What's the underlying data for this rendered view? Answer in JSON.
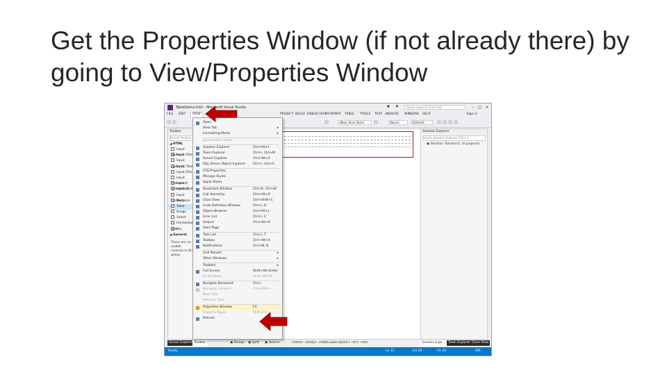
{
  "slide": {
    "title": "Get the Properties Window (if not already there) by going to View/Properties Window"
  },
  "window": {
    "title": "TableDemo.htm - Microsoft Visual Studio",
    "quick_launch": "Quick Launch (Ctrl+Q)",
    "sign_in": "Sign in"
  },
  "menu": {
    "items": [
      "FILE",
      "EDIT",
      "VIEW",
      "PROJECT",
      "BUILD",
      "DEBUG",
      "TEAM",
      "FORMAT",
      "TABLE",
      "TOOLS",
      "TEST",
      "ANALYZE",
      "WINDOW",
      "HELP"
    ]
  },
  "toolbar": {
    "style_select": "(New Inline Style)",
    "target_select": "(None)",
    "rule_select": "(Default)"
  },
  "toolbox": {
    "title": "Toolbox",
    "search": "Search Toolbox",
    "section": "HTML",
    "items": [
      "Input (Button)",
      "Input (Reset)",
      "Input (Submit)",
      "Input (Text)",
      "Input (File)",
      "Input (Password)",
      "Input (Checkbox)",
      "Input (Radio)",
      "Input (Hidden)",
      "Textarea",
      "Table",
      "Image",
      "Select",
      "Horizontal Rule",
      "Div"
    ],
    "general": "General",
    "general_text": "There are no usable controls in this group."
  },
  "view_menu": {
    "items": [
      {
        "label": "Open",
        "shortcut": "",
        "arrow": false,
        "disabled": false,
        "icon": "folder-icon"
      },
      {
        "label": "View Tab",
        "shortcut": "",
        "arrow": true,
        "disabled": false,
        "icon": ""
      },
      {
        "label": "Formatting Marks",
        "shortcut": "",
        "arrow": true,
        "disabled": false,
        "icon": ""
      },
      {
        "label": "Synchronize Views",
        "shortcut": "",
        "arrow": false,
        "disabled": true,
        "icon": ""
      },
      {
        "label": "Solution Explorer",
        "shortcut": "Ctrl+Alt+L",
        "arrow": false,
        "disabled": false,
        "icon": "solution-explorer-icon"
      },
      {
        "label": "Team Explorer",
        "shortcut": "Ctrl+\\, Ctrl+M",
        "arrow": false,
        "disabled": false,
        "icon": "team-explorer-icon"
      },
      {
        "label": "Server Explorer",
        "shortcut": "Ctrl+Alt+S",
        "arrow": false,
        "disabled": false,
        "icon": "server-explorer-icon"
      },
      {
        "label": "SQL Server Object Explorer",
        "shortcut": "Ctrl+\\, Ctrl+S",
        "arrow": false,
        "disabled": false,
        "icon": "sql-server-icon"
      },
      {
        "label": "CSS Properties",
        "shortcut": "",
        "arrow": false,
        "disabled": false,
        "icon": "css-properties-icon"
      },
      {
        "label": "Manage Styles",
        "shortcut": "",
        "arrow": false,
        "disabled": false,
        "icon": "manage-styles-icon"
      },
      {
        "label": "Apply Styles",
        "shortcut": "",
        "arrow": false,
        "disabled": false,
        "icon": "apply-styles-icon"
      },
      {
        "label": "Bookmark Window",
        "shortcut": "Ctrl+K, Ctrl+W",
        "arrow": false,
        "disabled": false,
        "icon": "bookmark-icon"
      },
      {
        "label": "Call Hierarchy",
        "shortcut": "Ctrl+Alt+K",
        "arrow": false,
        "disabled": false,
        "icon": "call-hierarchy-icon"
      },
      {
        "label": "Class View",
        "shortcut": "Ctrl+Shift+C",
        "arrow": false,
        "disabled": false,
        "icon": "class-view-icon"
      },
      {
        "label": "Code Definition Window",
        "shortcut": "Ctrl+\\, D",
        "arrow": false,
        "disabled": false,
        "icon": "code-definition-icon"
      },
      {
        "label": "Object Browser",
        "shortcut": "Ctrl+Alt+J",
        "arrow": false,
        "disabled": false,
        "icon": "object-browser-icon"
      },
      {
        "label": "Error List",
        "shortcut": "Ctrl+\\, E",
        "arrow": false,
        "disabled": false,
        "icon": "error-list-icon"
      },
      {
        "label": "Output",
        "shortcut": "Ctrl+Alt+O",
        "arrow": false,
        "disabled": false,
        "icon": "output-icon"
      },
      {
        "label": "Start Page",
        "shortcut": "",
        "arrow": false,
        "disabled": false,
        "icon": "start-page-icon"
      },
      {
        "label": "Task List",
        "shortcut": "Ctrl+\\, T",
        "arrow": false,
        "disabled": false,
        "icon": "task-list-icon"
      },
      {
        "label": "Toolbox",
        "shortcut": "Ctrl+Alt+X",
        "arrow": false,
        "disabled": false,
        "icon": "toolbox-icon"
      },
      {
        "label": "Notifications",
        "shortcut": "Ctrl+W, N",
        "arrow": false,
        "disabled": false,
        "icon": "notifications-icon"
      },
      {
        "label": "Find Results",
        "shortcut": "",
        "arrow": true,
        "disabled": false,
        "icon": ""
      },
      {
        "label": "Other Windows",
        "shortcut": "",
        "arrow": true,
        "disabled": false,
        "icon": ""
      },
      {
        "label": "Toolbars",
        "shortcut": "",
        "arrow": true,
        "disabled": false,
        "icon": ""
      },
      {
        "label": "Full Screen",
        "shortcut": "Shift+Alt+Enter",
        "arrow": false,
        "disabled": false,
        "icon": "full-screen-icon"
      },
      {
        "label": "All Windows",
        "shortcut": "Shift+Alt+M",
        "arrow": false,
        "disabled": true,
        "icon": ""
      },
      {
        "label": "Navigate Backward",
        "shortcut": "Ctrl+-",
        "arrow": false,
        "disabled": false,
        "icon": "navigate-back-icon"
      },
      {
        "label": "Navigate Forward",
        "shortcut": "Ctrl+Shift+-",
        "arrow": false,
        "disabled": true,
        "icon": "navigate-forward-icon"
      },
      {
        "label": "Next Task",
        "shortcut": "",
        "arrow": false,
        "disabled": true,
        "icon": ""
      },
      {
        "label": "Previous Task",
        "shortcut": "",
        "arrow": false,
        "disabled": true,
        "icon": ""
      },
      {
        "label": "Properties Window",
        "shortcut": "F4",
        "arrow": false,
        "disabled": false,
        "icon": "wrench-icon",
        "highlight": true
      },
      {
        "label": "Property Pages",
        "shortcut": "Shift+F4",
        "arrow": false,
        "disabled": true,
        "icon": ""
      },
      {
        "label": "Refresh",
        "shortcut": "",
        "arrow": false,
        "disabled": false,
        "icon": "refresh-icon"
      }
    ]
  },
  "solution_explorer": {
    "title": "Solution Explorer",
    "search": "Search Solution Explorer (Ctrl+;)",
    "tree_item": "Solution 'Solution1' (0 projects)"
  },
  "bottom_tabs": {
    "left": [
      "Server Explorer",
      "Toolbox"
    ],
    "editor": [
      "Design",
      "Split",
      "Source"
    ],
    "breadcrumb": "<html> <body> <table.auto-style1> <tr> <td>",
    "right": [
      "Solution Expl...",
      "Team Explorer",
      "Class View"
    ]
  },
  "status_bar": {
    "ready": "Ready",
    "line": "Ln 11",
    "col": "Col 20",
    "ch": "Ch 20",
    "ins": "INS"
  },
  "colors": {
    "accent": "#007acc",
    "arrow": "#c00000",
    "menu_highlight": "#fdf4bf"
  }
}
